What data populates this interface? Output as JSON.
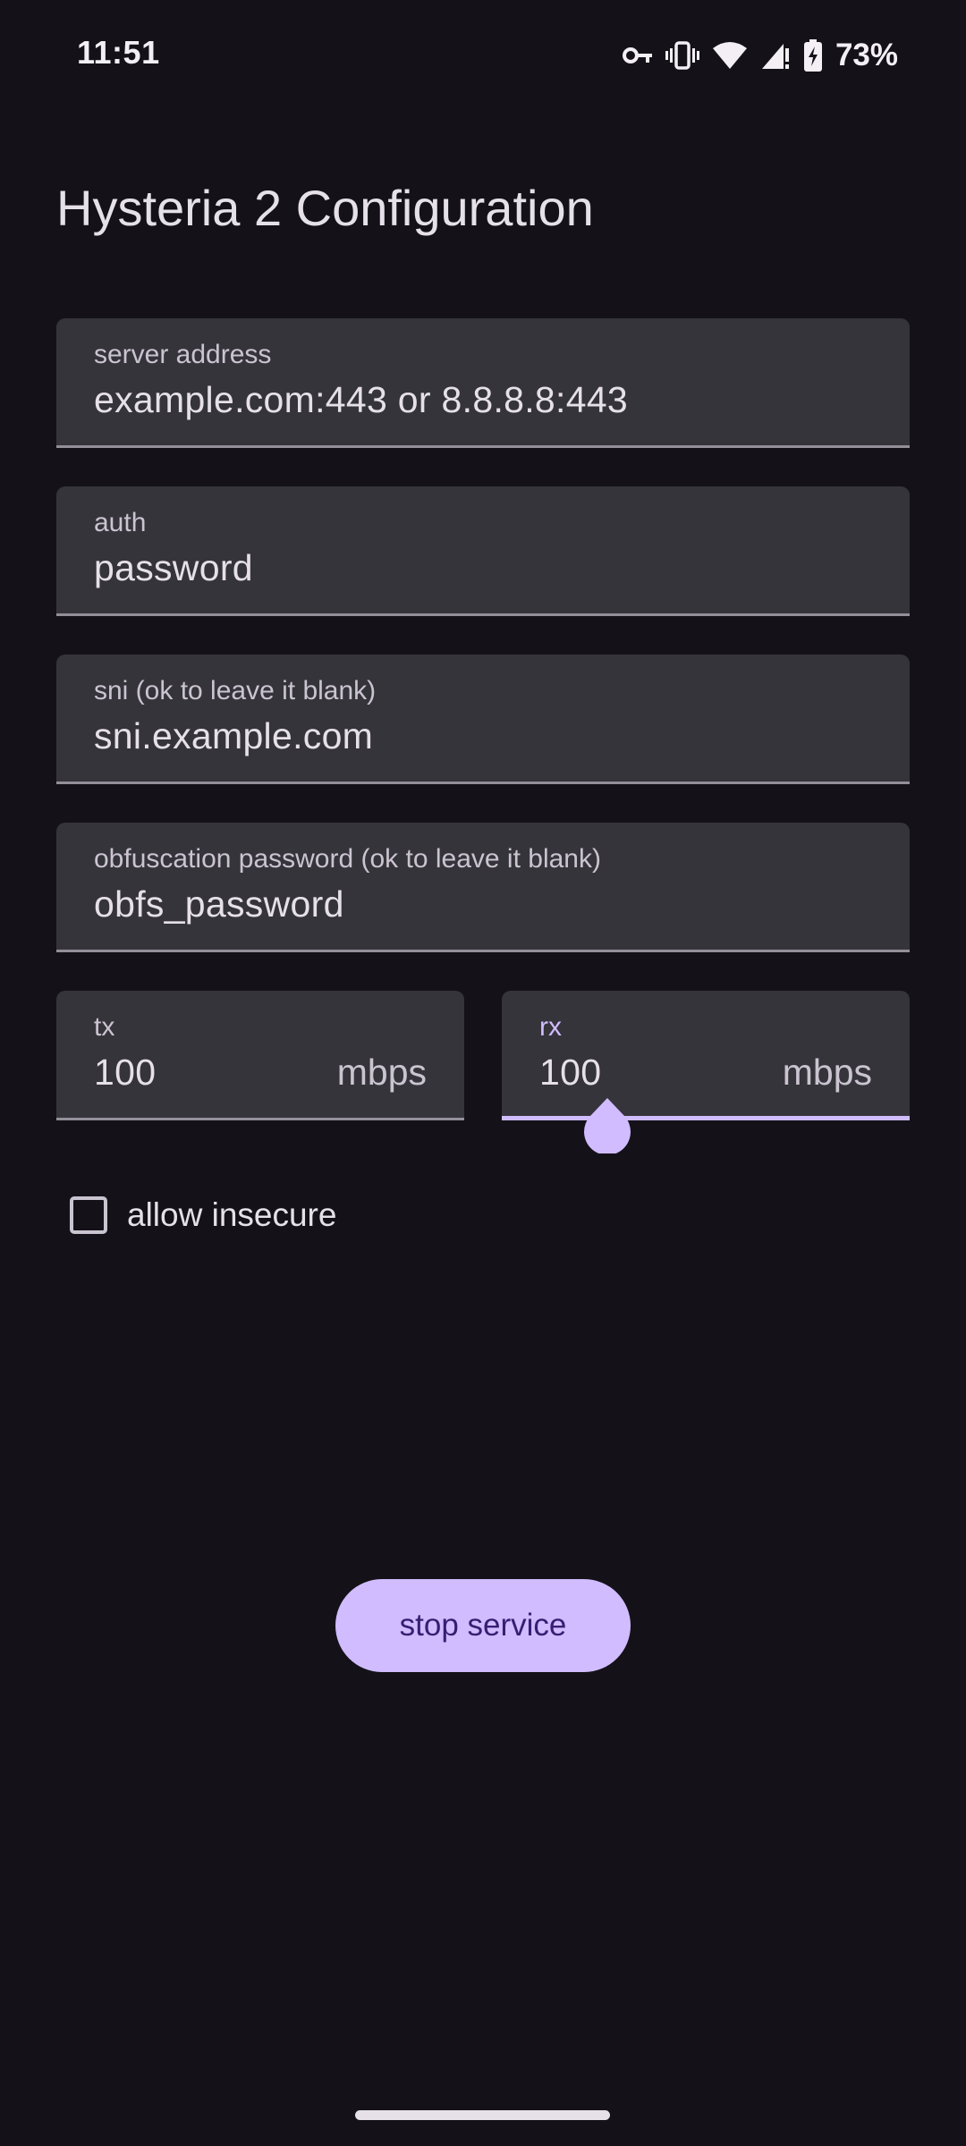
{
  "status_bar": {
    "time": "11:51",
    "battery_percent": "73%",
    "icons": [
      "vpn-key-icon",
      "vibrate-icon",
      "wifi-icon",
      "cellular-no-data-icon",
      "battery-charging-icon"
    ]
  },
  "title": "Hysteria 2 Configuration",
  "form": {
    "server": {
      "label": "server address",
      "value": "example.com:443 or 8.8.8.8:443"
    },
    "auth": {
      "label": "auth",
      "value": "password"
    },
    "sni": {
      "label": "sni (ok to leave it blank)",
      "value": "sni.example.com"
    },
    "obfs": {
      "label": "obfuscation password (ok to leave it blank)",
      "value": "obfs_password"
    },
    "tx": {
      "label": "tx",
      "value": "100",
      "suffix": "mbps"
    },
    "rx": {
      "label": "rx",
      "value": "100",
      "suffix": "mbps",
      "focused": true
    }
  },
  "allow_insecure": {
    "label": "allow insecure",
    "checked": false
  },
  "action_button": {
    "label": "stop service"
  },
  "colors": {
    "background": "#141218",
    "field_background": "#36343b",
    "accent": "#d0bcff",
    "on_accent": "#381e72",
    "text_primary": "#e6e0e9",
    "text_secondary": "#cac4d0"
  }
}
